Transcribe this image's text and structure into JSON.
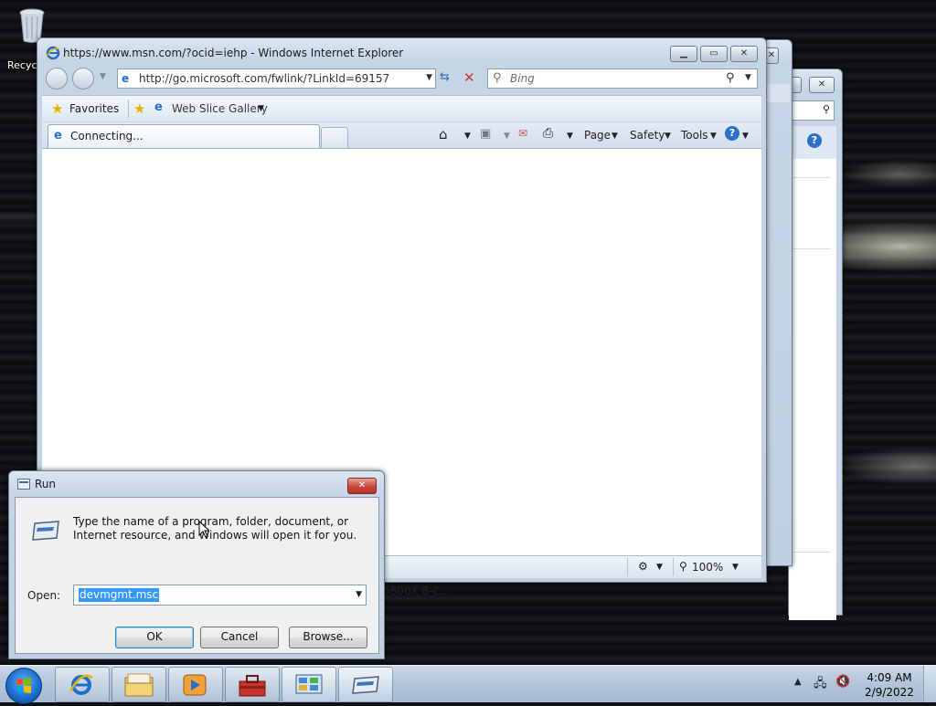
{
  "desktop": {
    "recycle_bin_label": "Recyc"
  },
  "background_windows": {
    "partial_text": "5800X 8-C..."
  },
  "ie": {
    "title": "https://www.msn.com/?ocid=iehp - Windows Internet Explorer",
    "address": "http://go.microsoft.com/fwlink/?LinkId=69157",
    "search_placeholder": "Bing",
    "favorites_label": "Favorites",
    "web_slice_label": "Web Slice Gallery",
    "tab_label": "Connecting...",
    "menu": {
      "page": "Page",
      "safety": "Safety",
      "tools": "Tools"
    },
    "zoom": "100%",
    "zoom_percent": 100
  },
  "run_dialog": {
    "title": "Run",
    "description": "Type the name of a program, folder, document, or Internet resource, and Windows will open it for you.",
    "open_label": "Open:",
    "open_value": "devmgmt.msc",
    "ok_label": "OK",
    "cancel_label": "Cancel",
    "browse_label": "Browse..."
  },
  "taskbar": {
    "time": "4:09 AM",
    "date": "2/9/2022",
    "apps": [
      "internet-explorer",
      "windows-explorer",
      "media-player",
      "toolbox",
      "control-panel",
      "run"
    ]
  },
  "colors": {
    "accent_blue": "#3399ff",
    "close_red": "#c9463d"
  }
}
